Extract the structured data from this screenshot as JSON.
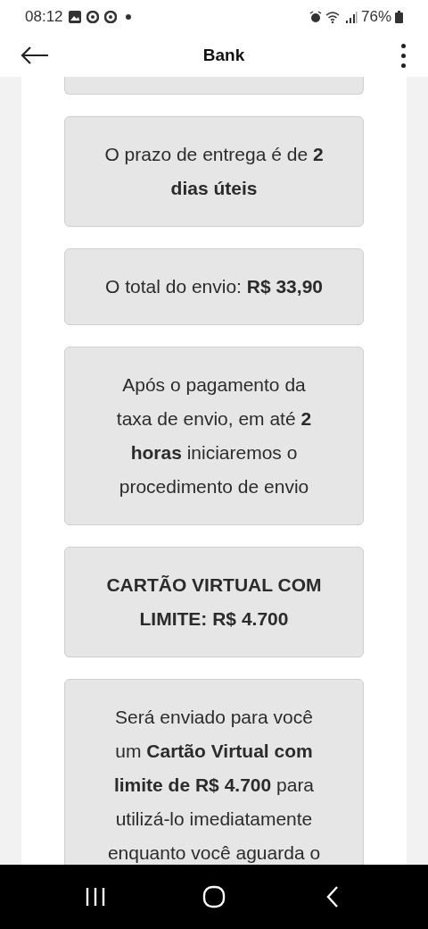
{
  "status_bar": {
    "time": "08:12",
    "battery": "76%"
  },
  "app_bar": {
    "title": "Bank"
  },
  "cards": [
    {
      "text": "O prazo de entrega é de **2 dias úteis**",
      "bold": false
    },
    {
      "text": "O total do envio: **R$ 33,90**",
      "bold": false
    },
    {
      "text": "Após o pagamento da taxa de envio, em até **2 horas** iniciaremos o procedimento de envio",
      "bold": false
    },
    {
      "text": "CARTÃO VIRTUAL COM LIMITE: R$ 4.700",
      "bold": true
    },
    {
      "text": "Será enviado para você um **Cartão Virtual com limite de R$ 4.700** para utilizá-lo imediatamente enquanto você aguarda o",
      "bold": false
    }
  ]
}
